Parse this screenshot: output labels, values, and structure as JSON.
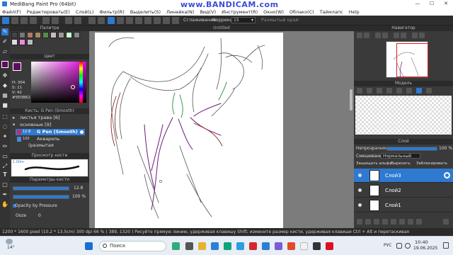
{
  "window": {
    "title": "MediBang Paint Pro (64bit)",
    "minimize": "—",
    "maximize": "☐",
    "close": "✕"
  },
  "watermark": "www.BANDICAM.com",
  "menu": [
    "Файл(F)",
    "Редактировать(E)",
    "Слой(L)",
    "Фильтр(R)",
    "Выделить(S)",
    "Линейка(N)",
    "Вид(V)",
    "Инструмент(R)",
    "Окно(W)",
    "Облако(C)",
    "Таймлапс",
    "Help"
  ],
  "toolbar": {
    "smoothing": "Сглаживание",
    "correction_label": "Коррекция",
    "correction_value": "15",
    "dropdown_arrow": "▾",
    "hard_edge": "Размытый край"
  },
  "panels": {
    "palette": "Палитра",
    "color": "Цвет",
    "brush": "Кисть: G Pen (Smooth)",
    "brush_preview": "Просмотр кисти",
    "brush_params": "Параметры кисти",
    "navigator": "Навигатор",
    "model": "Модель",
    "layer": "Слой"
  },
  "color": {
    "h": "H: 304",
    "s": "S: 11",
    "v": "V: 42",
    "hex": "#5E0B62"
  },
  "brushes": {
    "groups": [
      {
        "arrow": "▸",
        "label": "листья трава",
        "count": "[6]"
      },
      {
        "arrow": "▾",
        "label": "основные",
        "count": "[9]"
      }
    ],
    "items": [
      {
        "size": "12.8",
        "label": "G Pen (Smooth)"
      },
      {
        "size": "100",
        "label": "Акварель (размытая"
      }
    ]
  },
  "brush_preview_size": "1.00m",
  "brush_params": {
    "size": "12.8",
    "opacity": "100 %",
    "opacity_by_pressure": "Opacity by Pressure",
    "ooze": "Ooze",
    "ooze_value": "0"
  },
  "canvas": {
    "tab": "Untitled"
  },
  "layers": {
    "opacity_label": "Непрозрачность",
    "opacity_value": "100 %",
    "blend_label": "Смешивание",
    "blend_value": "Нормальный",
    "protect_alpha": "Защищать альфа",
    "clip": "Вырезать",
    "lock": "Заблокировать",
    "items": [
      {
        "name": "Слой3",
        "selected": true
      },
      {
        "name": "Слой2",
        "selected": false
      },
      {
        "name": "Слой1",
        "selected": false
      }
    ]
  },
  "status": "1200 * 1600 pixel  (10.2 * 13.5cm)  300 dpi   66 %   ( 389, 1320 )   Рисуйте прямую линию, удерживая клавишу Shift; измените размер кисти, удерживая клавиши Ctrl + Alt и перетаскивая",
  "taskbar": {
    "weather": "14°",
    "search_placeholder": "Поиск",
    "lang": "РУС",
    "time": "10:40",
    "date": "19.06.2025"
  },
  "colors": {
    "accent": "#2e7ad1",
    "foreground": "#5e0b62",
    "panel": "#3a3a3a"
  }
}
